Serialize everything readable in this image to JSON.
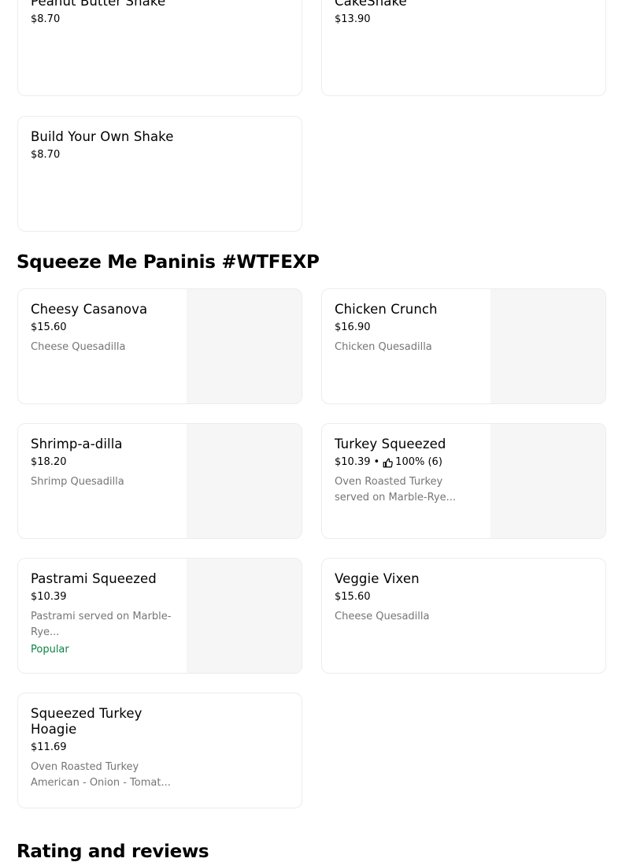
{
  "shakes": {
    "items": [
      {
        "name": "Peanut Butter Shake",
        "price": "$8.70"
      },
      {
        "name": "CakeShake",
        "price": "$13.90"
      },
      {
        "name": "Build Your Own Shake",
        "price": "$8.70"
      }
    ]
  },
  "paninis": {
    "title": "Squeeze Me Paninis #WTFEXP",
    "items": [
      {
        "name": "Cheesy Casanova",
        "price": "$15.60",
        "description": "Cheese Quesadilla"
      },
      {
        "name": "Chicken Crunch",
        "price": "$16.90",
        "description": "Chicken Quesadilla"
      },
      {
        "name": "Shrimp-a-dilla",
        "price": "$18.20",
        "description": "Shrimp Quesadilla"
      },
      {
        "name": "Turkey Squeezed",
        "price": "$10.39",
        "rating_separator": "•",
        "rating": "100% (6)",
        "description": "Oven Roasted Turkey served on Marble-Rye..."
      },
      {
        "name": "Pastrami Squeezed",
        "price": "$10.39",
        "description": "Pastrami served on Marble-Rye...",
        "badge": "Popular"
      },
      {
        "name": "Veggie Vixen",
        "price": "$15.60",
        "description": "Cheese Quesadilla"
      },
      {
        "name": "Squeezed Turkey Hoagie",
        "price": "$11.69",
        "description": "Oven Roasted Turkey American - Onion - Tomat..."
      }
    ]
  },
  "reviews": {
    "title": "Rating and reviews"
  },
  "colors": {
    "popular_badge": "#0e8345",
    "description": "#757575",
    "thumbnail_placeholder": "#f6f6f6",
    "card_border": "#ececec"
  },
  "icons": {
    "rating": "thumbs-up-icon"
  }
}
